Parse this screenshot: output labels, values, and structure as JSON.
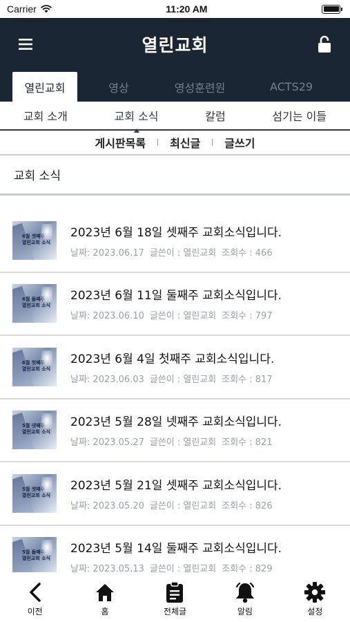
{
  "statusbar": {
    "carrier": "Carrier",
    "time": "11:20 AM",
    "battery_level": 1.0
  },
  "navbar": {
    "title": "열린교회"
  },
  "tabs": [
    {
      "label": "열린교회",
      "active": true
    },
    {
      "label": "영상",
      "active": false
    },
    {
      "label": "영성훈련원",
      "active": false
    },
    {
      "label": "ACTS29",
      "active": false
    }
  ],
  "subtabs": [
    {
      "label": "교회 소개",
      "active": false
    },
    {
      "label": "교회 소식",
      "active": true
    },
    {
      "label": "칼럼",
      "active": false
    },
    {
      "label": "섬기는 이들",
      "active": false
    }
  ],
  "board_nav": {
    "list": "게시판목록",
    "recent": "최신글",
    "write": "글쓰기"
  },
  "section": {
    "title": "교회 소식"
  },
  "posts": [
    {
      "title": "2023년 6월 18일 셋째주 교회소식입니다.",
      "date": "날짜: 2023.06.17",
      "author": "글쓴이 : 열린교회",
      "views": "조회수 : 466",
      "thumb_line1": "6월 셋째주",
      "thumb_line2": "열린교회 소식"
    },
    {
      "title": "2023년 6월 11일 둘째주 교회소식입니다.",
      "date": "날짜: 2023.06.10",
      "author": "글쓴이 : 열린교회",
      "views": "조회수 : 797",
      "thumb_line1": "6월 둘째주",
      "thumb_line2": "열린교회 소식"
    },
    {
      "title": "2023년 6월 4일 첫째주 교회소식입니다.",
      "date": "날짜: 2023.06.03",
      "author": "글쓴이 : 열린교회",
      "views": "조회수 : 817",
      "thumb_line1": "6월 첫째주",
      "thumb_line2": "열린교회 소식"
    },
    {
      "title": "2023년 5월 28일 넷째주 교회소식입니다.",
      "date": "날짜: 2023.05.27",
      "author": "글쓴이 : 열린교회",
      "views": "조회수 : 821",
      "thumb_line1": "5월 넷째주",
      "thumb_line2": "열린교회 소식"
    },
    {
      "title": "2023년 5월 21일 셋째주 교회소식입니다.",
      "date": "날짜: 2023.05.20",
      "author": "글쓴이 : 열린교회",
      "views": "조회수 : 826",
      "thumb_line1": "5월 셋째주",
      "thumb_line2": "열린교회 소식"
    },
    {
      "title": "2023년 5월 14일 둘째주 교회소식입니다.",
      "date": "날짜: 2023.05.13",
      "author": "글쓴이 : 열린교회",
      "views": "조회수 : 829",
      "thumb_line1": "5월 둘째주",
      "thumb_line2": "열린교회 소식"
    }
  ],
  "bottom_nav": [
    {
      "label": "이전",
      "icon": "chevron-left-icon"
    },
    {
      "label": "홈",
      "icon": "home-icon"
    },
    {
      "label": "전체글",
      "icon": "clipboard-icon"
    },
    {
      "label": "알림",
      "icon": "bell-icon"
    },
    {
      "label": "설정",
      "icon": "gear-icon"
    }
  ],
  "colors": {
    "navbar": "#1a2634",
    "inactive_tab": "#77808c",
    "meta_text": "#9aa0a6"
  }
}
